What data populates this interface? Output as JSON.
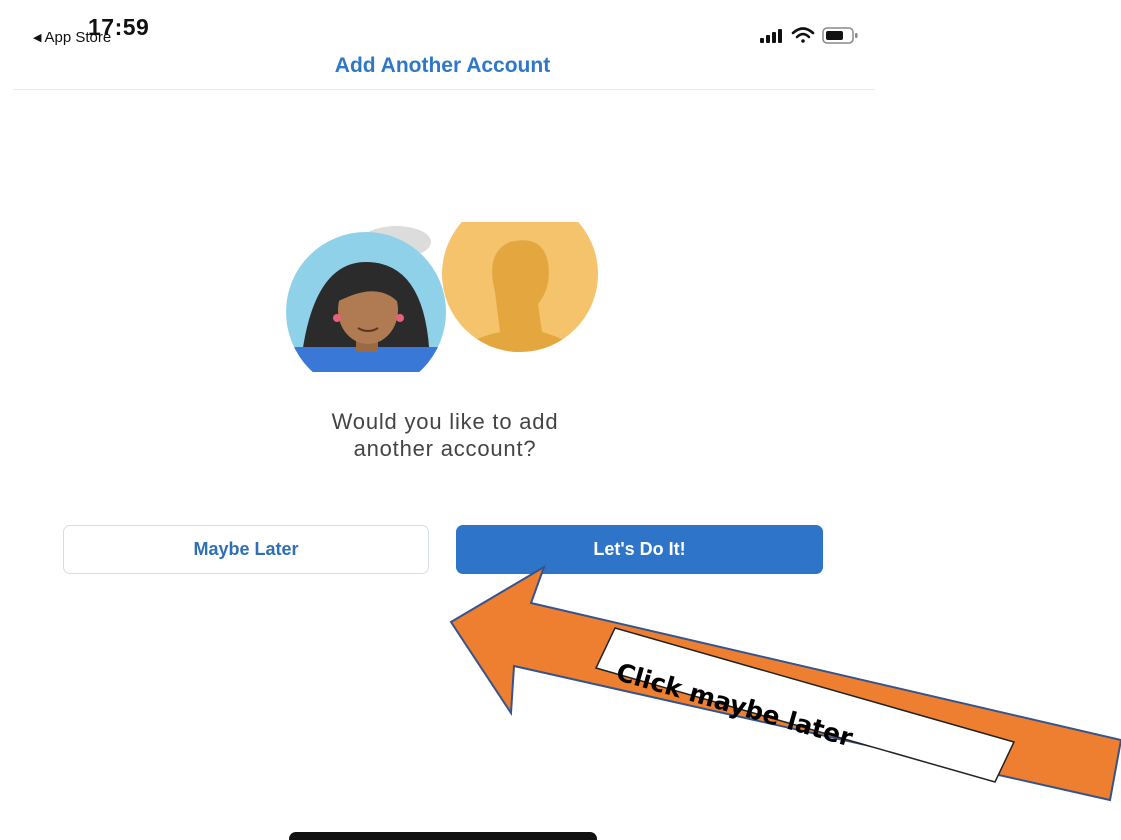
{
  "status_bar": {
    "time": "17:59",
    "back_label": "App Store",
    "back_glyph": "◀"
  },
  "nav": {
    "title": "Add Another Account"
  },
  "prompt": {
    "line1": "Would you like to add",
    "line2": "another account?"
  },
  "buttons": {
    "maybe_later": "Maybe Later",
    "do_it": "Let's Do It!"
  },
  "annotation": {
    "callout_text": "Click maybe later"
  },
  "colors": {
    "accent": "#2f78c8",
    "primary_button": "#2e74c9",
    "arrow_fill": "#ee7f31",
    "arrow_stroke": "#35548c"
  },
  "icons": {
    "signal": "cellular-signal-icon",
    "wifi": "wifi-icon",
    "battery": "battery-icon"
  }
}
